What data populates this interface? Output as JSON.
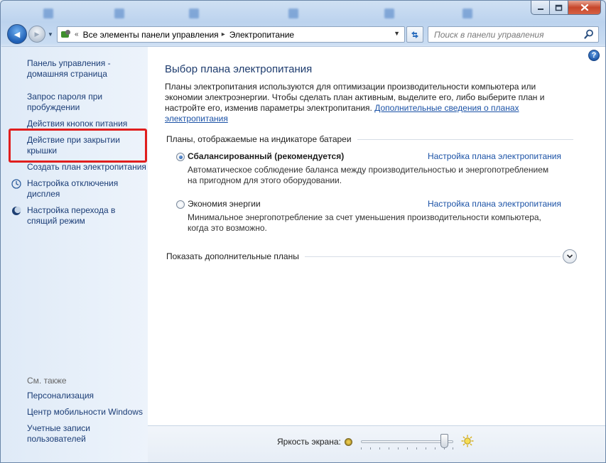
{
  "window": {
    "min_label": "▁",
    "max_label": "□",
    "close_label": "✕"
  },
  "navigation": {
    "back_glyph": "◀",
    "forward_glyph": "▶",
    "history_glyph": "▼",
    "breadcrumb_lead": "«",
    "crumbs": [
      "Все элементы панели управления",
      "Электропитание"
    ],
    "crumb_sep": "▸",
    "address_dropdown": "▼",
    "refresh_glyph": "↻"
  },
  "search": {
    "placeholder": "Поиск в панели управления"
  },
  "sidebar": {
    "links": [
      {
        "label": "Панель управления - домашняя страница"
      },
      {
        "label": "Запрос пароля при пробуждении"
      },
      {
        "label": "Действия кнопок питания"
      },
      {
        "label": "Действие при закрытии крышки"
      },
      {
        "label": "Создать план электропитания"
      },
      {
        "label": "Настройка отключения дисплея"
      },
      {
        "label": "Настройка перехода в спящий режим"
      }
    ],
    "see_also_heading": "См. также",
    "see_also": [
      {
        "label": "Персонализация"
      },
      {
        "label": "Центр мобильности Windows"
      },
      {
        "label": "Учетные записи пользователей"
      }
    ]
  },
  "main": {
    "help_glyph": "?",
    "title": "Выбор плана электропитания",
    "intro_text": "Планы электропитания используются для оптимизации производительности компьютера или экономии электроэнергии. Чтобы сделать план активным, выделите его, либо выберите план и настройте его, изменив параметры электропитания.",
    "intro_link": "Дополнительные сведения о планах электропитания",
    "group_heading": "Планы, отображаемые на индикаторе батареи",
    "plans": [
      {
        "name": "Сбалансированный (рекомендуется)",
        "selected": true,
        "link": "Настройка плана электропитания",
        "description": "Автоматическое соблюдение баланса между производительностью и энергопотреблением на пригодном для этого оборудовании."
      },
      {
        "name": "Экономия энергии",
        "selected": false,
        "link": "Настройка плана электропитания",
        "description": "Минимальное энергопотребление за счет уменьшения производительности компьютера, когда это возможно."
      }
    ],
    "more_plans_label": "Показать дополнительные планы",
    "expand_glyph": "⌄"
  },
  "brightness": {
    "label": "Яркость экрана:",
    "level_fraction": 0.94
  },
  "colors": {
    "link": "#1b3d76",
    "highlight_box": "#e01e1e",
    "title": "#1e3c6e"
  }
}
